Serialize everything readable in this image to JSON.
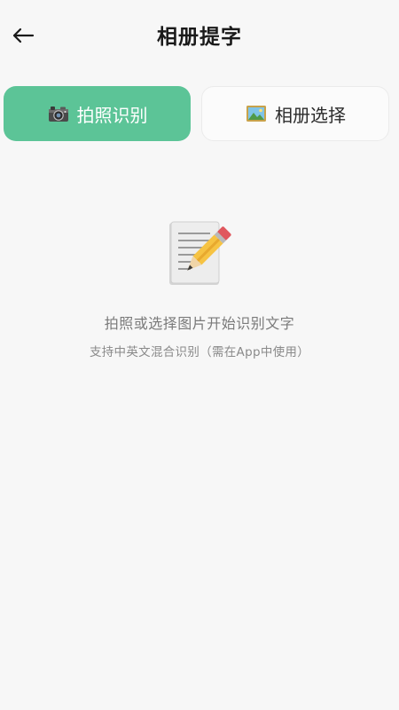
{
  "header": {
    "title": "相册提字",
    "back_icon": "arrow-left-icon"
  },
  "modes": {
    "camera": {
      "label": "拍照识别",
      "icon": "camera-icon",
      "active": true
    },
    "album": {
      "label": "相册选择",
      "icon": "picture-icon",
      "active": false
    }
  },
  "empty_state": {
    "icon": "note-pencil-icon",
    "message": "拍照或选择图片开始识别文字",
    "submessage": "支持中英文混合识别（需在App中使用）"
  },
  "colors": {
    "accent": "#5cc497",
    "background": "#f7f7f7",
    "text_primary": "#1a1a1a",
    "text_secondary": "#7a7a7a"
  }
}
